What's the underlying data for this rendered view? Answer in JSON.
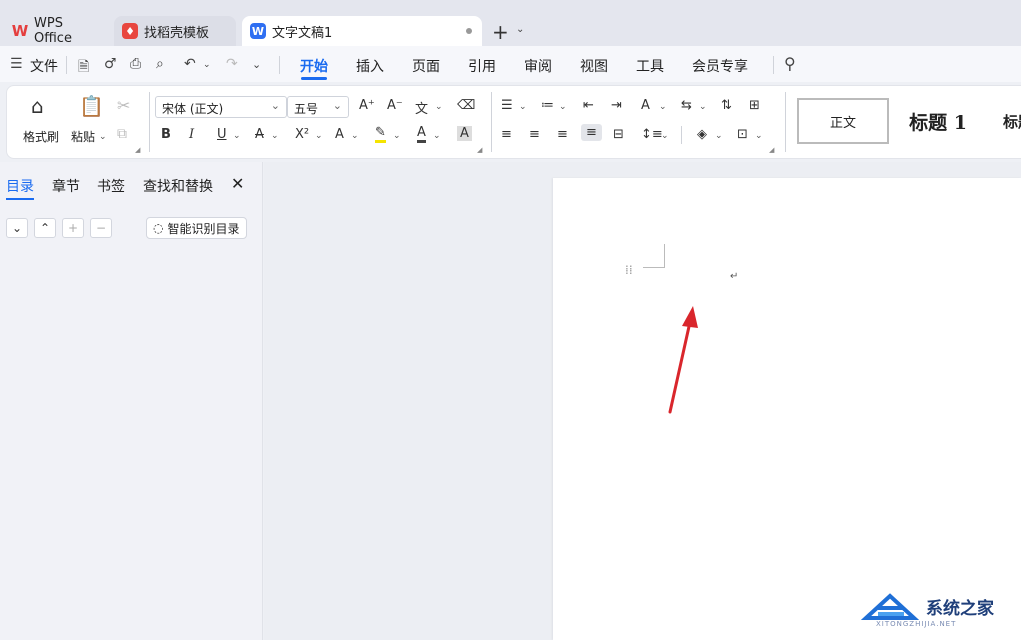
{
  "tabs": [
    {
      "label": "WPS Office",
      "icon": "wps-logo-icon"
    },
    {
      "label": "找稻壳模板",
      "icon": "docer-icon"
    },
    {
      "label": "文字文稿1",
      "icon": "writer-doc-icon"
    }
  ],
  "menu": {
    "file_label": "文件",
    "items": [
      "开始",
      "插入",
      "页面",
      "引用",
      "审阅",
      "视图",
      "工具",
      "会员专享"
    ],
    "active": "开始"
  },
  "ribbon": {
    "format_painter": "格式刷",
    "paste": "粘贴",
    "font_name": "宋体 (正文)",
    "font_size": "五号",
    "styles": [
      "正文",
      "标题 1",
      "标题"
    ]
  },
  "sidepanel": {
    "tabs": [
      "目录",
      "章节",
      "书签",
      "查找和替换"
    ],
    "active_tab": "目录",
    "smart_toc_label": "智能识别目录"
  },
  "watermark": {
    "name": "系统之家",
    "domain": "XITONGZHIJIA.NET"
  },
  "colors": {
    "accent": "#1a6bf0",
    "annotation_arrow": "#d9262c",
    "wps_red": "#e43e3e"
  }
}
